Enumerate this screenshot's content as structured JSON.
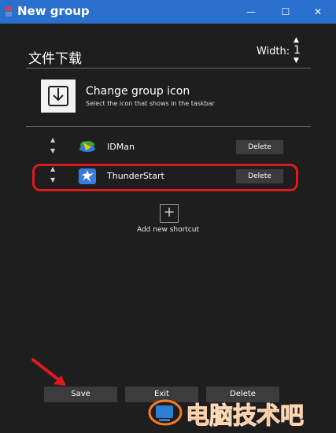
{
  "window": {
    "title": "New group",
    "minimize": "—",
    "maximize": "☐",
    "close": "✕"
  },
  "group": {
    "name": "文件下载",
    "width_label": "Width:",
    "width_value": "1"
  },
  "group_icon": {
    "title": "Change group icon",
    "subtitle": "Select the icon that shows in the taskbar"
  },
  "shortcuts": [
    {
      "label": "IDMan",
      "delete_label": "Delete",
      "icon": "idman-icon"
    },
    {
      "label": "ThunderStart",
      "delete_label": "Delete",
      "icon": "thunder-icon"
    }
  ],
  "add_shortcut": {
    "label": "Add new shortcut",
    "symbol": "+"
  },
  "buttons": {
    "save": "Save",
    "exit": "Exit",
    "delete": "Delete"
  },
  "watermark": {
    "text": "电脑技术吧"
  },
  "colors": {
    "titlebar": "#2a6fcb",
    "highlight": "#e0191e",
    "watermark": "#ff7a1a"
  }
}
